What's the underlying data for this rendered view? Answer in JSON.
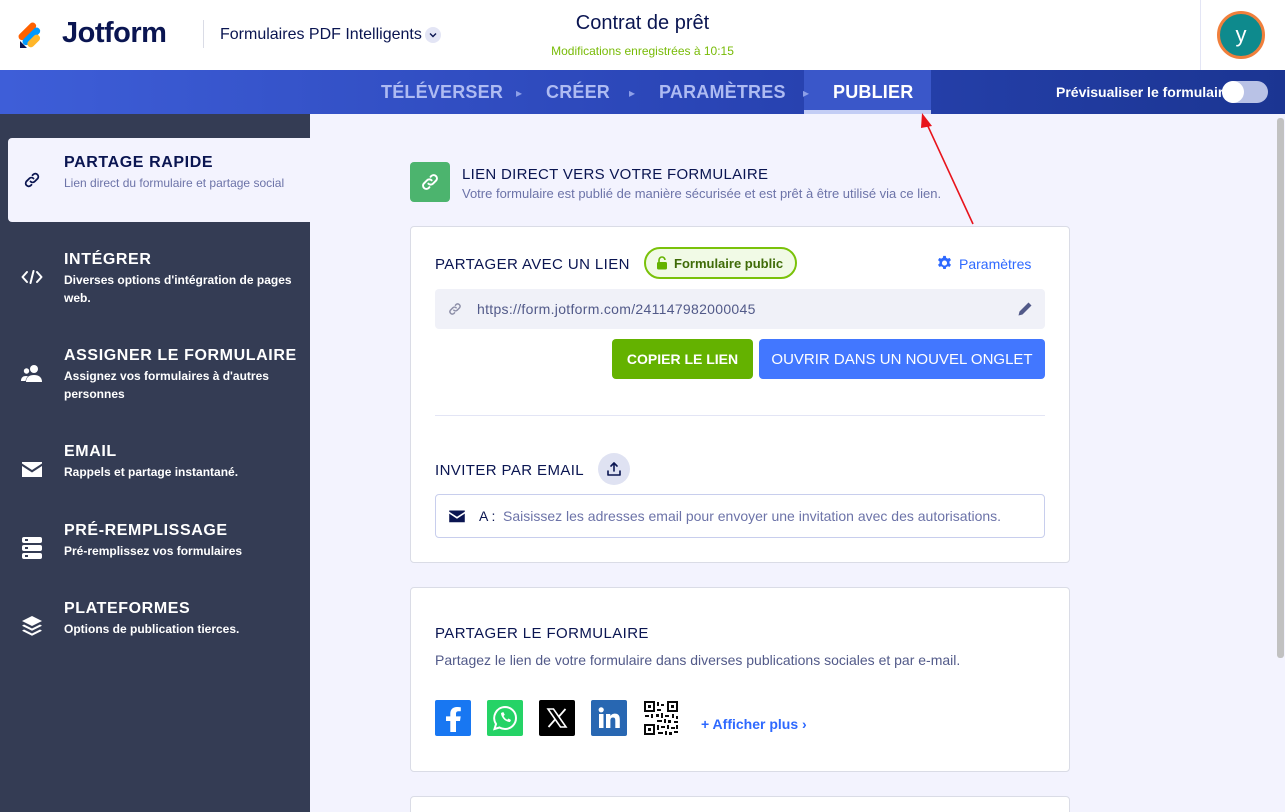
{
  "header": {
    "brand": "Jotform",
    "product": "Formulaires PDF Intelligents",
    "form_title": "Contrat de prêt",
    "save_status": "Modifications enregistrées à 10:15",
    "avatar_initial": "y"
  },
  "nav": {
    "tabs": [
      "TÉLÉVERSER",
      "CRÉER",
      "PARAMÈTRES",
      "PUBLIER"
    ],
    "active_tab": "PUBLIER",
    "preview_label": "Prévisualiser le formulaire",
    "preview_on": false
  },
  "sidebar": {
    "items": [
      {
        "title": "PARTAGE RAPIDE",
        "desc": "Lien direct du formulaire et partage social",
        "icon": "link-icon",
        "active": true
      },
      {
        "title": "INTÉGRER",
        "desc": "Diverses options d'intégration de pages web.",
        "icon": "code-icon",
        "active": false
      },
      {
        "title": "ASSIGNER LE FORMULAIRE",
        "desc": "Assignez vos formulaires à d'autres personnes",
        "icon": "users-icon",
        "active": false
      },
      {
        "title": "EMAIL",
        "desc": "Rappels et partage instantané.",
        "icon": "envelope-icon",
        "active": false
      },
      {
        "title": "PRÉ-REMPLISSAGE",
        "desc": "Pré-remplissez vos formulaires",
        "icon": "database-icon",
        "active": false
      },
      {
        "title": "PLATEFORMES",
        "desc": "Options de publication tierces.",
        "icon": "layers-icon",
        "active": false
      }
    ]
  },
  "main": {
    "heading": "LIEN DIRECT VERS VOTRE FORMULAIRE",
    "subheading": "Votre formulaire est publié de manière sécurisée et est prêt à être utilisé via ce lien.",
    "link_card": {
      "title": "PARTAGER AVEC UN LIEN",
      "badge": "Formulaire public",
      "settings_label": "Paramètres",
      "url": "https://form.jotform.com/241147982000045",
      "copy_label": "COPIER LE LIEN",
      "open_label": "OUVRIR DANS UN NOUVEL ONGLET",
      "invite_title": "INVITER PAR EMAIL",
      "email_to": "A :",
      "email_placeholder": "Saisissez les adresses email pour envoyer une invitation avec des autorisations."
    },
    "share_card": {
      "title": "PARTAGER LE FORMULAIRE",
      "desc": "Partagez le lien de votre formulaire dans diverses publications sociales et par e-mail.",
      "networks": [
        "facebook-icon",
        "whatsapp-icon",
        "x-icon",
        "linkedin-icon",
        "qrcode-icon"
      ],
      "show_more": "+ Afficher plus"
    }
  },
  "colors": {
    "primary_blue": "#4277ff",
    "green": "#64b200",
    "sidebar_bg": "#343c54",
    "nav_bg": "#2a45b6",
    "annotation_arrow": "#e8141c"
  }
}
